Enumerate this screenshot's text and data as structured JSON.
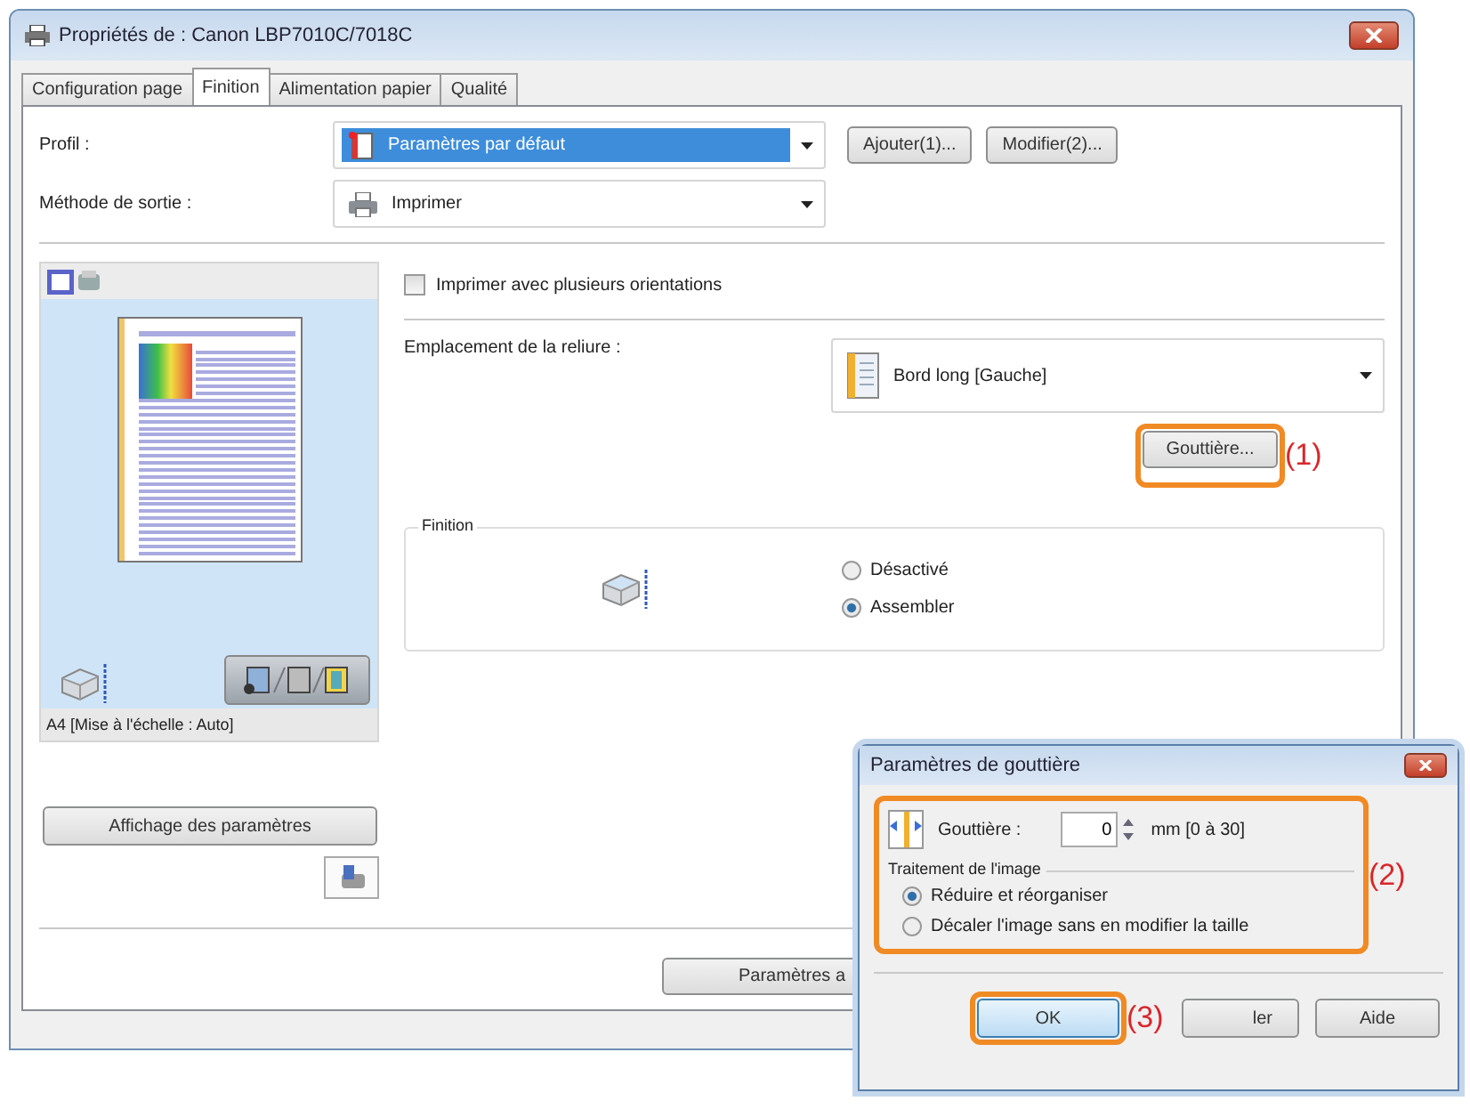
{
  "window": {
    "title": "Propriétés de : Canon LBP7010C/7018C"
  },
  "tabs": [
    {
      "label": "Configuration page",
      "selected": false
    },
    {
      "label": "Finition",
      "selected": true
    },
    {
      "label": "Alimentation papier",
      "selected": false
    },
    {
      "label": "Qualité",
      "selected": false
    }
  ],
  "profile": {
    "label": "Profil :",
    "value": "Paramètres par défaut",
    "highlighted": true,
    "buttons": [
      "Ajouter(1)...",
      "Modifier(2)..."
    ]
  },
  "output_method": {
    "label": "Méthode de sortie :",
    "value": "Imprimer"
  },
  "preview": {
    "caption": "A4 [Mise à l'échelle : Auto]",
    "button": "Affichage des paramètres"
  },
  "orientation_option": {
    "label": "Imprimer avec plusieurs orientations",
    "checked": false
  },
  "binding": {
    "label": "Emplacement de la reliure :",
    "value": "Bord long [Gauche]",
    "gutter_button": {
      "label": "Gouttière...",
      "callout": "(1)"
    }
  },
  "finishing": {
    "title": "Finition",
    "options": [
      {
        "label": "Désactivé",
        "selected": false
      },
      {
        "label": "Assembler",
        "selected": true
      }
    ]
  },
  "bottom_button": "Paramètres a",
  "dialog": {
    "title": "Paramètres de gouttière",
    "callout": "(2)",
    "gutter_label": "Gouttière :",
    "gutter_value": "0",
    "unit": "mm [0 à 30]",
    "group_title": "Traitement de l'image",
    "options": [
      {
        "label": "Réduire et réorganiser",
        "selected": true
      },
      {
        "label": "Décaler l'image sans en modifier la taille",
        "selected": false
      }
    ],
    "buttons": [
      {
        "label": "OK",
        "callout": "(3)"
      },
      {
        "label": "ler"
      },
      {
        "label": "Aide"
      }
    ]
  }
}
